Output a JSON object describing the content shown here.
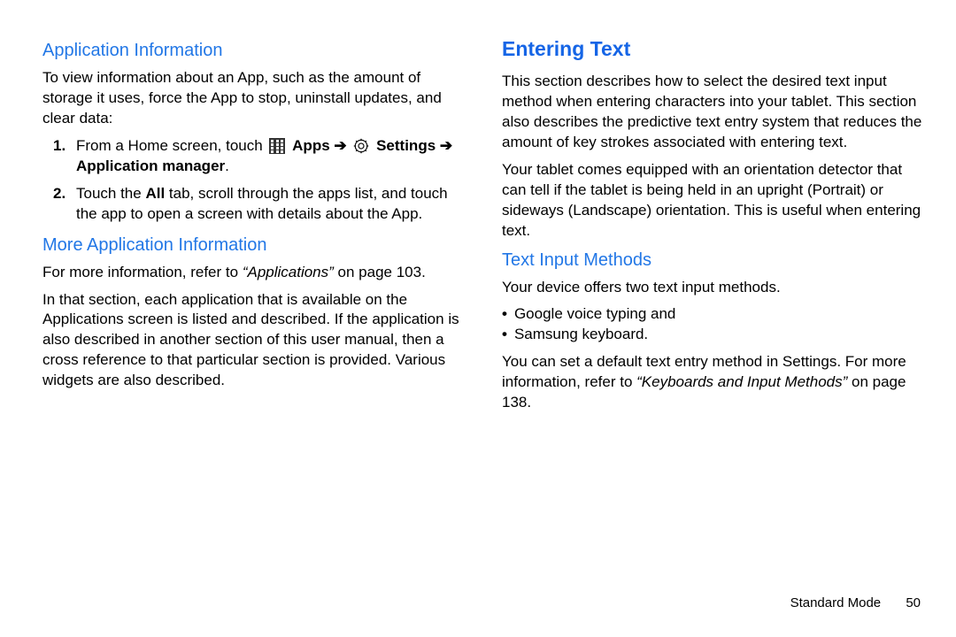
{
  "left": {
    "h1": "Application Information",
    "p1": "To view information about an App, such as the amount of storage it uses, force the App to stop, uninstall updates, and clear data:",
    "steps": [
      {
        "num": "1.",
        "pre": "From a Home screen, touch ",
        "apps_label": "Apps",
        "arrow1": " ➔ ",
        "settings_label": "Settings",
        "arrow2": " ➔ ",
        "appmgr_label": "Application manager",
        "post": "."
      },
      {
        "num": "2.",
        "pre": "Touch the ",
        "all_label": "All",
        "post": " tab, scroll through the apps list, and touch the app to open a screen with details about the App."
      }
    ],
    "h2": "More Application Information",
    "p2a": "For more information, refer to ",
    "p2xref": "“Applications”",
    "p2b": " on page 103.",
    "p3": "In that section, each application that is available on the Applications screen is listed and described. If the application is also described in another section of this user manual, then a cross reference to that particular section is provided. Various widgets are also described."
  },
  "right": {
    "h1": "Entering Text",
    "p1": "This section describes how to select the desired text input method when entering characters into your tablet. This section also describes the predictive text entry system that reduces the amount of key strokes associated with entering text.",
    "p2": "Your tablet comes equipped with an orientation detector that can tell if the tablet is being held in an upright (Portrait) or sideways (Landscape) orientation. This is useful when entering text.",
    "h2": "Text Input Methods",
    "p3": "Your device offers two text input methods.",
    "bullets": [
      "Google voice typing and",
      "Samsung keyboard."
    ],
    "p4a": "You can set a default text entry method in Settings. For more information, refer to ",
    "p4xref": "“Keyboards and Input Methods”",
    "p4b": " on page 138."
  },
  "footer": {
    "section": "Standard Mode",
    "page": "50"
  }
}
